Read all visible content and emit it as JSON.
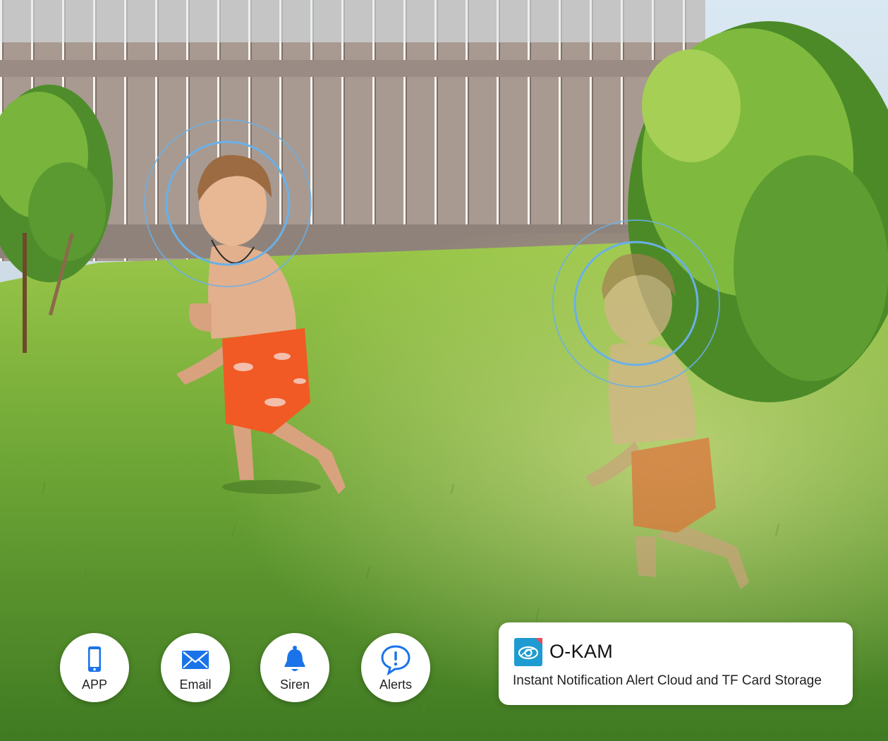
{
  "features": [
    {
      "label": "APP",
      "icon": "smartphone-icon"
    },
    {
      "label": "Email",
      "icon": "envelope-icon"
    },
    {
      "label": "Siren",
      "icon": "bell-icon"
    },
    {
      "label": "Alerts",
      "icon": "alert-bubble-icon"
    }
  ],
  "notification": {
    "app_name": "O-KAM",
    "description": "Instant Notification Alert Cloud and TF Card Storage",
    "logo_icon": "o-kam-eye-logo-icon"
  },
  "colors": {
    "accent_blue": "#1a73e8",
    "detection_ring": "#6ab0e8",
    "logo_teal": "#1e9bd0"
  }
}
